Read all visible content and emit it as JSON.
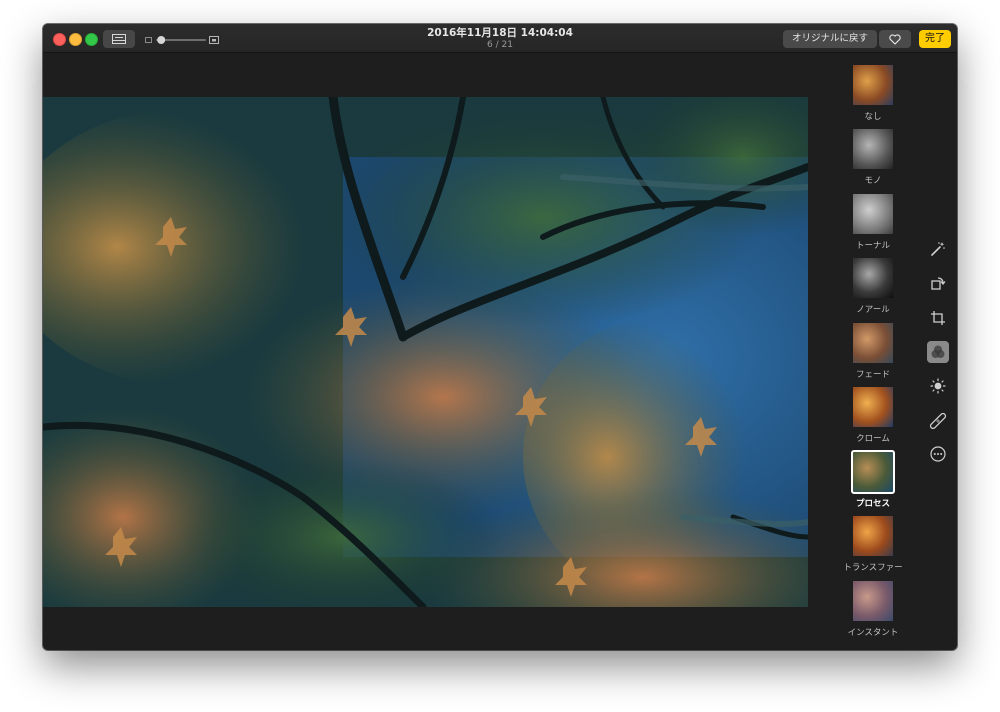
{
  "window": {
    "title": "2016年11月18日 14:04:04",
    "position": "6 / 21"
  },
  "toolbar": {
    "revert_label": "オリジナルに戻す",
    "done_label": "完了",
    "zoom_level": 0.05
  },
  "filters": [
    {
      "label": "なし",
      "style": "none"
    },
    {
      "label": "モノ",
      "style": "mono"
    },
    {
      "label": "トーナル",
      "style": "tonal"
    },
    {
      "label": "ノアール",
      "style": "noir"
    },
    {
      "label": "フェード",
      "style": "fade"
    },
    {
      "label": "クローム",
      "style": "chrome"
    },
    {
      "label": "プロセス",
      "style": "process",
      "selected": true
    },
    {
      "label": "トランスファー",
      "style": "transfer"
    },
    {
      "label": "インスタント",
      "style": "instant"
    }
  ],
  "tools": [
    {
      "name": "enhance-icon"
    },
    {
      "name": "rotate-icon"
    },
    {
      "name": "crop-icon"
    },
    {
      "name": "filters-icon",
      "active": true
    },
    {
      "name": "adjust-icon"
    },
    {
      "name": "retouch-icon"
    },
    {
      "name": "more-icon"
    }
  ],
  "colors": {
    "accent": "#ffcc00",
    "window_bg": "#1e1e1e",
    "button_bg": "#4a4a4a"
  }
}
